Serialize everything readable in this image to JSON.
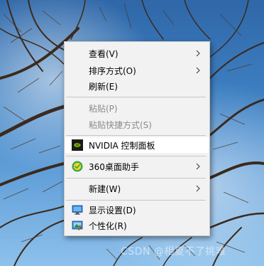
{
  "desktop": {
    "watermark": "CSDN @相夏不了挑难"
  },
  "context_menu": {
    "items": [
      {
        "label": "查看(V)"
      },
      {
        "label": "排序方式(O)"
      },
      {
        "label": "刷新(E)"
      },
      {
        "label": "粘贴(P)"
      },
      {
        "label": "粘贴快捷方式(S)"
      },
      {
        "label": "NVIDIA 控制面板"
      },
      {
        "label": "360桌面助手"
      },
      {
        "label": "新建(W)"
      },
      {
        "label": "显示设置(D)"
      },
      {
        "label": "个性化(R)"
      }
    ]
  },
  "icons": {
    "view_submenu": "chevron-right-icon",
    "nvidia": "nvidia-logo-icon",
    "desktop_assistant": "360-assistant-icon",
    "display_settings": "monitor-icon",
    "personalize": "personalize-icon"
  },
  "colors": {
    "menu_bg": "#f2f2f2",
    "highlight_bg": "#ffffff",
    "disabled_text": "#8b8b8b",
    "nvidia_green": "#76b900"
  }
}
